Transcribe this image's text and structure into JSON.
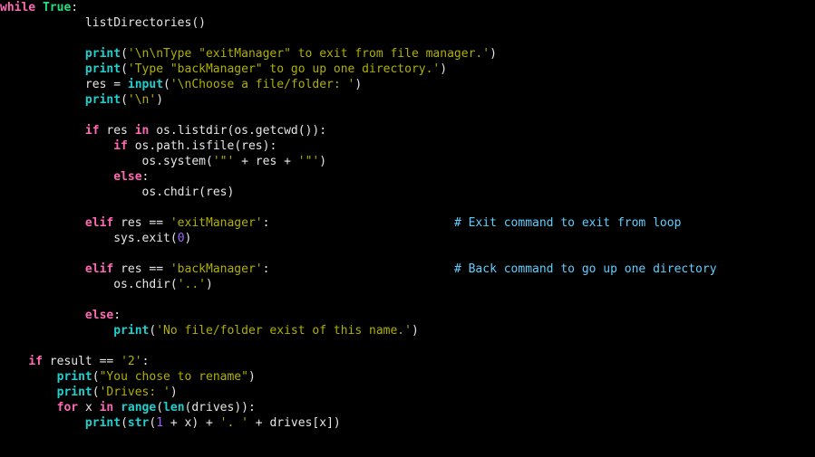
{
  "code": {
    "kw_while": "while",
    "bool_true": "True",
    "colon": ":",
    "fn_listDirectories": "listDirectories",
    "lp": "(",
    "rp": ")",
    "fn_print": "print",
    "str_exitmsg": "'\\n\\nType \"exitManager\" to exit from file manager.'",
    "str_backmsg": "'Type \"backManager\" to go up one directory.'",
    "id_res": "res",
    "op_assign": " = ",
    "fn_input": "input",
    "str_choose": "'\\nChoose a file/folder: '",
    "str_nl": "'\\n'",
    "kw_if": "if",
    "kw_in": "in",
    "id_os": "os",
    "dot": ".",
    "fn_listdir": "listdir",
    "fn_getcwd": "getcwd",
    "id_path": "path",
    "fn_isfile": "isfile",
    "fn_system": "system",
    "str_tq1": "'\"'",
    "op_plus": " + ",
    "kw_else": "else",
    "fn_chdir": "chdir",
    "kw_elif": "elif",
    "op_eq": " == ",
    "str_exitManager": "'exitManager'",
    "cmt_exit": "# Exit command to exit from loop",
    "id_sys": "sys",
    "fn_exit": "exit",
    "num_0": "0",
    "str_backManager": "'backManager'",
    "cmt_back": "# Back command to go up one directory",
    "str_dotdot": "'..'",
    "str_nofile": "'No file/folder exist of this name.'",
    "id_result": "result",
    "str_2": "'2'",
    "str_rename": "\"You chose to rename\"",
    "str_drives": "'Drives: '",
    "kw_for": "for",
    "id_x": "x",
    "fn_range": "range",
    "fn_len": "len",
    "id_drives": "drives",
    "fn_str": "str",
    "num_1": "1",
    "str_dotsp": "'. '",
    "lb": "[",
    "rb": "]"
  }
}
